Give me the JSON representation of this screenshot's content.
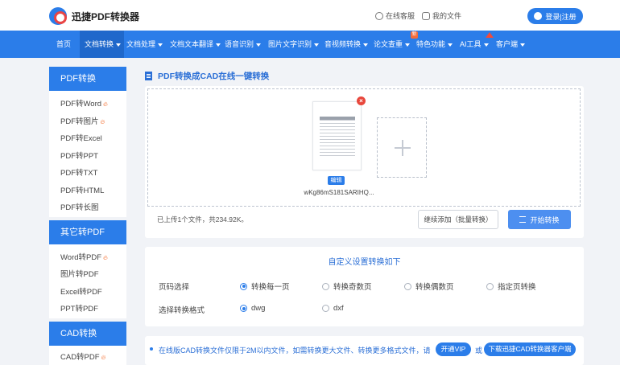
{
  "header": {
    "logo_text": "迅捷PDF转换器",
    "service_label": "在线客服",
    "files_label": "我的文件",
    "login_label": "登录|注册"
  },
  "nav": [
    {
      "label": "首页"
    },
    {
      "label": "文档转换"
    },
    {
      "label": "文档处理"
    },
    {
      "label": "文档文本翻译"
    },
    {
      "label": "语音识别"
    },
    {
      "label": "图片文字识别"
    },
    {
      "label": "音视频转换"
    },
    {
      "label": "论文查重",
      "badge": "新"
    },
    {
      "label": "特色功能"
    },
    {
      "label": "AI工具"
    },
    {
      "label": "客户端"
    }
  ],
  "sidebar": {
    "sections": [
      {
        "title": "PDF转换",
        "items": [
          {
            "label": "PDF转Word",
            "hot": true
          },
          {
            "label": "PDF转图片",
            "hot": true
          },
          {
            "label": "PDF转Excel"
          },
          {
            "label": "PDF转PPT"
          },
          {
            "label": "PDF转TXT"
          },
          {
            "label": "PDF转HTML"
          },
          {
            "label": "PDF转长图"
          }
        ]
      },
      {
        "title": "其它转PDF",
        "items": [
          {
            "label": "Word转PDF",
            "hot": true
          },
          {
            "label": "图片转PDF"
          },
          {
            "label": "Excel转PDF"
          },
          {
            "label": "PPT转PDF"
          }
        ]
      },
      {
        "title": "CAD转换",
        "items": [
          {
            "label": "CAD转PDF",
            "hot": true
          }
        ]
      }
    ],
    "hot_icon": "fire-icon"
  },
  "main": {
    "title": "PDF转换成CAD在线一键转换",
    "file_name": "wKg86mS181SARIHQ...",
    "edit_label": "编辑",
    "upload_info": "已上传1个文件，共234.92K。",
    "continue_label": "继续添加（批量转换）",
    "start_label": "开始转换"
  },
  "settings": {
    "title": "自定义设置转换如下",
    "page_label": "页码选择",
    "page_options": [
      "转换每一页",
      "转换奇数页",
      "转换偶数页",
      "指定页转换"
    ],
    "page_selected": "转换每一页",
    "format_label": "选择转换格式",
    "format_options": [
      "dwg",
      "dxf"
    ],
    "format_selected": "dwg"
  },
  "notice": {
    "text": "在线版CAD转换文件仅限于2M以内文件，如需转换更大文件、转换更多格式文件，请",
    "vip_label": "开通VIP",
    "or_label": "或",
    "download_label": "下载迅捷CAD转换器客户端"
  },
  "colors": {
    "brand": "#2b7de9",
    "hot": "#f36b2b",
    "delete": "#e8473c"
  }
}
